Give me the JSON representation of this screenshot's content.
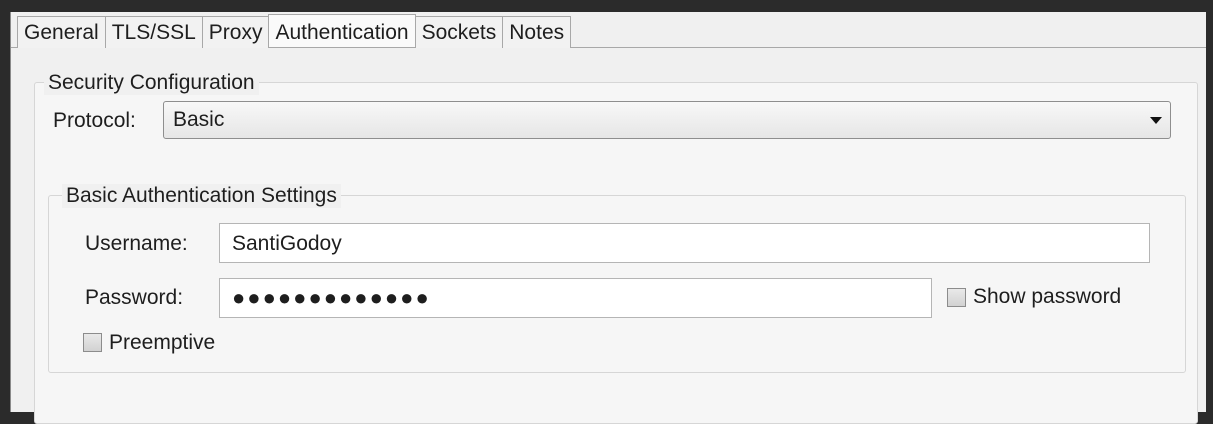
{
  "tabs": [
    {
      "label": "General"
    },
    {
      "label": "TLS/SSL"
    },
    {
      "label": "Proxy"
    },
    {
      "label": "Authentication",
      "active": true
    },
    {
      "label": "Sockets"
    },
    {
      "label": "Notes"
    }
  ],
  "security": {
    "group_title": "Security Configuration",
    "protocol_label": "Protocol:",
    "protocol_value": "Basic"
  },
  "basic_auth": {
    "group_title": "Basic Authentication Settings",
    "username_label": "Username:",
    "username_value": "SantiGodoy",
    "password_label": "Password:",
    "password_mask": "●●●●●●●●●●●●●",
    "show_password_label": "Show password",
    "show_password_checked": false,
    "preemptive_label": "Preemptive",
    "preemptive_checked": false
  }
}
